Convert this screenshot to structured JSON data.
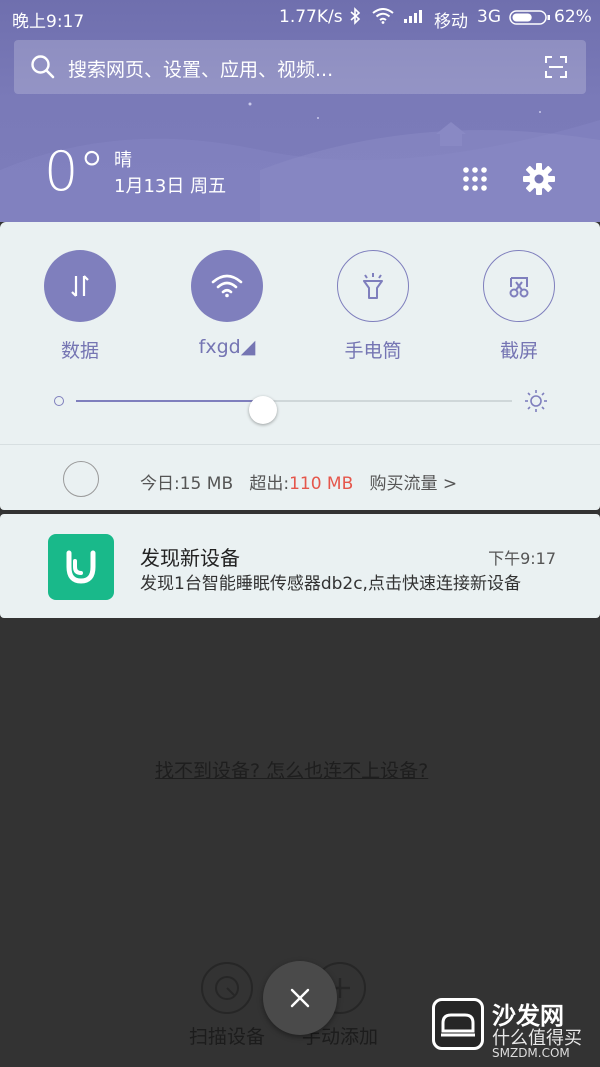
{
  "status_bar": {
    "time": "晚上9:17",
    "speed": "1.77K/s",
    "carrier": "移动",
    "network": "3G",
    "battery": "62%",
    "battery_level": 0.62
  },
  "search": {
    "placeholder": "搜索网页、设置、应用、视频..."
  },
  "weather": {
    "temperature": "0°",
    "condition": "晴",
    "date": "1月13日 周五"
  },
  "icons": {
    "bluetooth": "bluetooth-icon",
    "wifi": "wifi-icon",
    "signal": "signal-icon",
    "battery": "battery-icon",
    "search": "search-icon",
    "scan": "scan-icon",
    "grid": "grid-icon",
    "settings": "gear-icon"
  },
  "quick_toggles": [
    {
      "label": "数据",
      "active": true,
      "icon": "data-arrows-icon"
    },
    {
      "label": "fxgd◢",
      "active": true,
      "icon": "wifi-icon"
    },
    {
      "label": "手电筒",
      "active": false,
      "icon": "flashlight-icon"
    },
    {
      "label": "截屏",
      "active": false,
      "icon": "screenshot-icon"
    }
  ],
  "brightness": {
    "level": 0.43
  },
  "data_usage": {
    "today_label": "今日:",
    "today_value": "15 MB",
    "over_label": "超出:",
    "over_value": "110 MB",
    "buy_label": "购买流量 >"
  },
  "notification": {
    "title": "发现新设备",
    "time": "下午9:17",
    "body": "发现1台智能睡眠传感器db2c,点击快速连接新设备",
    "app_color": "#19b98a"
  },
  "background_app": {
    "help_link": "找不到设备? 怎么也连不上设备?",
    "scan_label": "扫描设备",
    "manual_label": "手动添加"
  },
  "watermark": {
    "name": "沙发网",
    "slogan": "什么值得买",
    "url": "SMZDM.COM"
  },
  "colors": {
    "accent": "#7f7fbd",
    "header": "#7777b5",
    "panel": "#eaf1f2",
    "overage": "#e5564b",
    "backdrop": "#333333"
  }
}
